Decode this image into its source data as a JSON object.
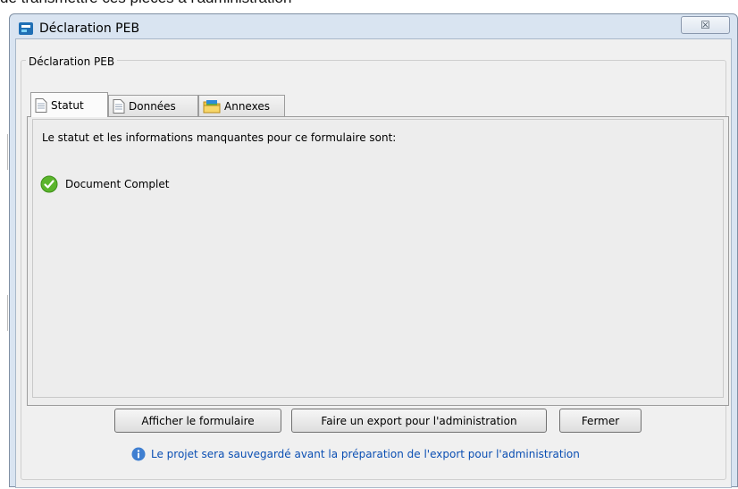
{
  "background": {
    "caption": "de transmettre ces pièces à l'administration"
  },
  "window": {
    "title": "Déclaration PEB",
    "close_glyph": "☒",
    "group_label": "Déclaration PEB"
  },
  "tabs": [
    {
      "label": "Statut",
      "icon": "document-icon",
      "active": true
    },
    {
      "label": "Données",
      "icon": "document-icon",
      "active": false
    },
    {
      "label": "Annexes",
      "icon": "folder-icon",
      "active": false
    }
  ],
  "status_panel": {
    "heading": "Le statut et les informations manquantes pour ce formulaire sont:",
    "status": {
      "icon": "check-circle-icon",
      "text": "Document Complet"
    }
  },
  "buttons": {
    "show_form": "Afficher le formulaire",
    "export": "Faire un export pour l'administration",
    "close": "Fermer"
  },
  "info": {
    "icon": "info-icon",
    "text": "Le projet sera sauvegardé avant la préparation de l'export pour l'administration"
  },
  "colors": {
    "title_bar": "#d9e4f1",
    "client": "#f0f0f0",
    "info_text": "#0b4fb3",
    "status_green": "#5bb52c"
  }
}
